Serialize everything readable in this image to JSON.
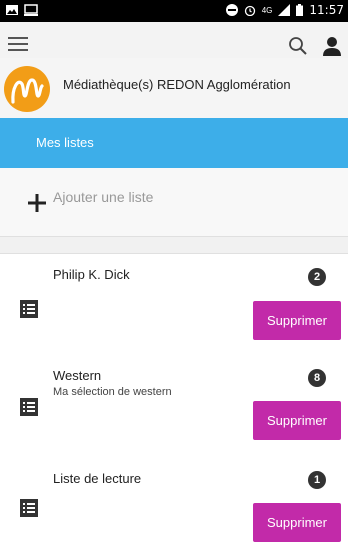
{
  "status_bar": {
    "time": "11:57",
    "network": "4G",
    "icons": [
      "image-icon",
      "cast-icon",
      "dnd-icon",
      "alarm-icon",
      "signal-icon",
      "battery-icon"
    ]
  },
  "header": {
    "brand_title": "Médiathèque(s) REDON Agglomération",
    "logo_icon": "logo-m-icon",
    "menu_icon": "menu-icon",
    "search_icon": "search-icon",
    "user_icon": "user-icon"
  },
  "page": {
    "title": "Mes listes",
    "add_label": "Ajouter une liste"
  },
  "lists": [
    {
      "title": "Philip K. Dick",
      "description": "",
      "count": "2",
      "delete_label": "Supprimer"
    },
    {
      "title": "Western",
      "description": "Ma sélection de western",
      "count": "8",
      "delete_label": "Supprimer"
    },
    {
      "title": "Liste de lecture",
      "description": "",
      "count": "1",
      "delete_label": "Supprimer"
    }
  ],
  "colors": {
    "accent_blue": "#3daee9",
    "button_magenta": "#c22aa9",
    "logo_orange": "#f29d17"
  }
}
